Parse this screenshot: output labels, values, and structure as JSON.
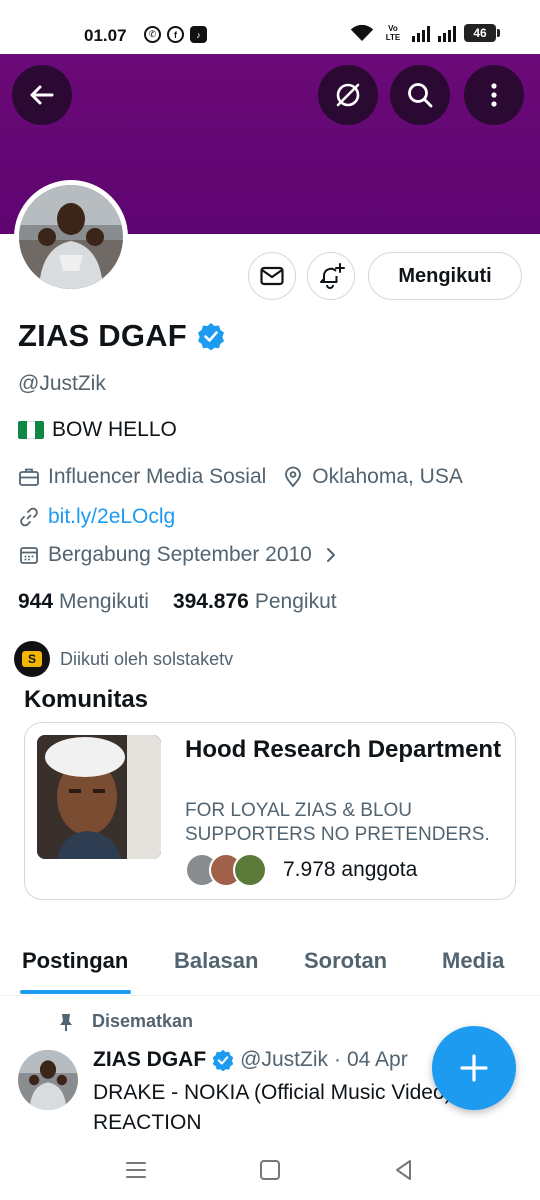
{
  "status_bar": {
    "time": "01.07",
    "apps": [
      "whatsapp-icon",
      "facebook-icon",
      "tiktok-icon"
    ],
    "network": "Vo LTE",
    "battery": "46"
  },
  "header": {
    "banner_color": "#6b0a78",
    "buttons": [
      "back-arrow-icon",
      "translate-off-icon",
      "search-icon",
      "more-vertical-icon"
    ]
  },
  "profile": {
    "name": "ZIAS DGAF",
    "handle": "@JustZik",
    "bio": "BOW HELLO",
    "bio_flag": "nigeria-flag",
    "category": "Influencer Media Sosial",
    "location": "Oklahoma, USA",
    "website": "bit.ly/2eLOclg",
    "joined": "Bergabung September 2010",
    "following_count": "944",
    "following_label": "Mengikuti",
    "followers_count": "394.876",
    "followers_label": "Pengikut",
    "follow_button_label": "Mengikuti",
    "followed_by": "Diikuti oleh solstaketv"
  },
  "communities": {
    "section_title": "Komunitas",
    "item": {
      "name": "Hood Research Department",
      "description": "FOR LOYAL ZIAS & BLOU SUPPORTERS NO PRETENDERS.",
      "members": "7.978 anggota"
    }
  },
  "tabs": [
    {
      "label": "Postingan",
      "active": true
    },
    {
      "label": "Balasan",
      "active": false
    },
    {
      "label": "Sorotan",
      "active": false
    },
    {
      "label": "Media",
      "active": false
    }
  ],
  "tweet": {
    "pinned_label": "Disematkan",
    "author_name": "ZIAS DGAF",
    "author_handle": "@JustZik",
    "separator": "·",
    "date": "04 Apr",
    "text": "DRAKE - NOKIA (Official Music Video) REACTION"
  },
  "colors": {
    "accent": "#1d9bf0",
    "text": "#0f1419",
    "secondary": "#536471",
    "border": "#cfd9de"
  }
}
